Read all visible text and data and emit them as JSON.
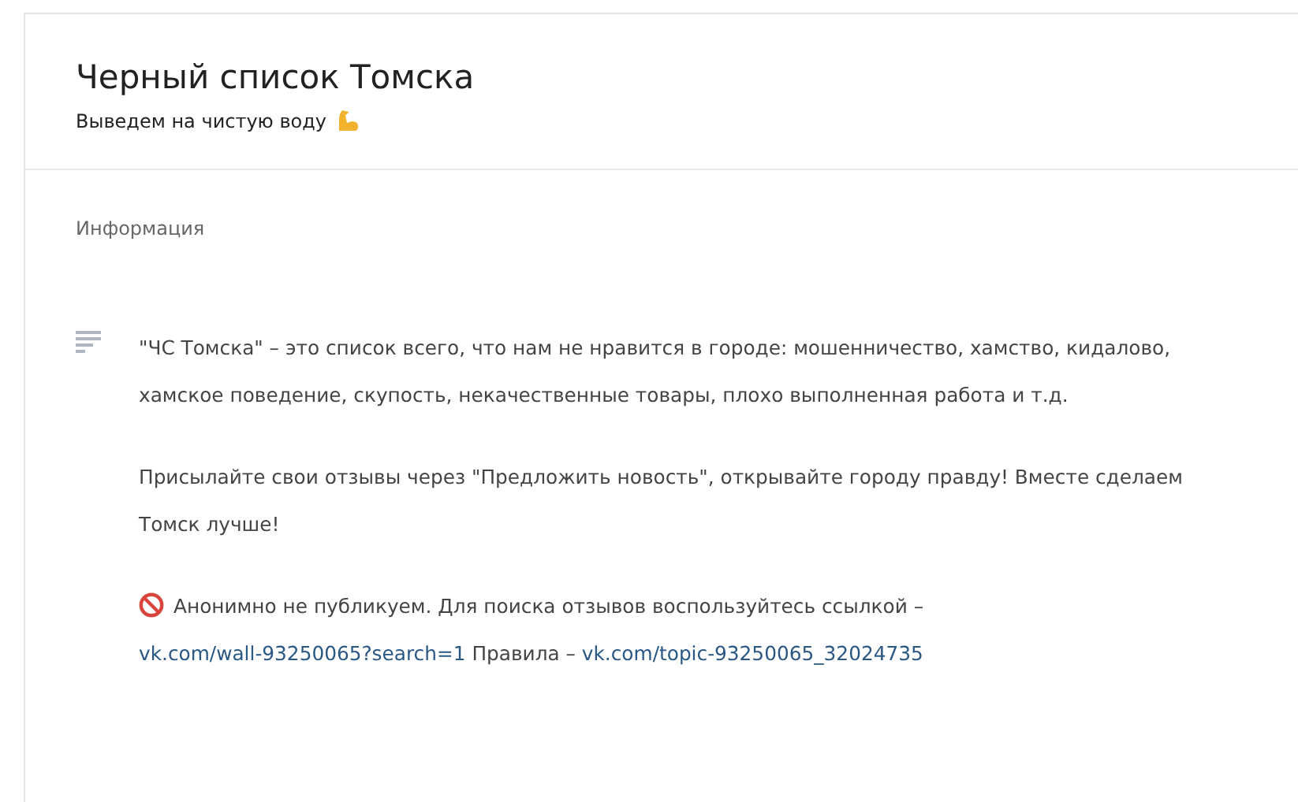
{
  "header": {
    "title": "Черный список Томска",
    "subtitle": "Выведем на чистую воду"
  },
  "section": {
    "title": "Информация",
    "paragraphs": [
      {
        "kind": "plain",
        "segments": [
          {
            "kind": "text",
            "text": "\"ЧС Томска\" – это список всего, что нам не нравится в городе: мошенничество, хамство, кидалово, хамское поведение, скупость, некачественные товары, плохо выполненная работа и т.д."
          }
        ]
      },
      {
        "kind": "plain",
        "segments": [
          {
            "kind": "text",
            "text": "Присылайте свои отзывы через \"Предложить новость\", открывайте городу правду! Вместе сделаем Томск лучше!"
          }
        ]
      },
      {
        "kind": "notice",
        "segments": [
          {
            "kind": "text",
            "text": "Анонимно не публикуем. Для поиска отзывов воспользуйтесь ссылкой –"
          },
          {
            "kind": "link",
            "text": "vk.com/wall-93250065?search=1"
          },
          {
            "kind": "text",
            "text": "Правила –"
          },
          {
            "kind": "link",
            "text": "vk.com/topic-93250065_32024735"
          }
        ]
      }
    ]
  }
}
